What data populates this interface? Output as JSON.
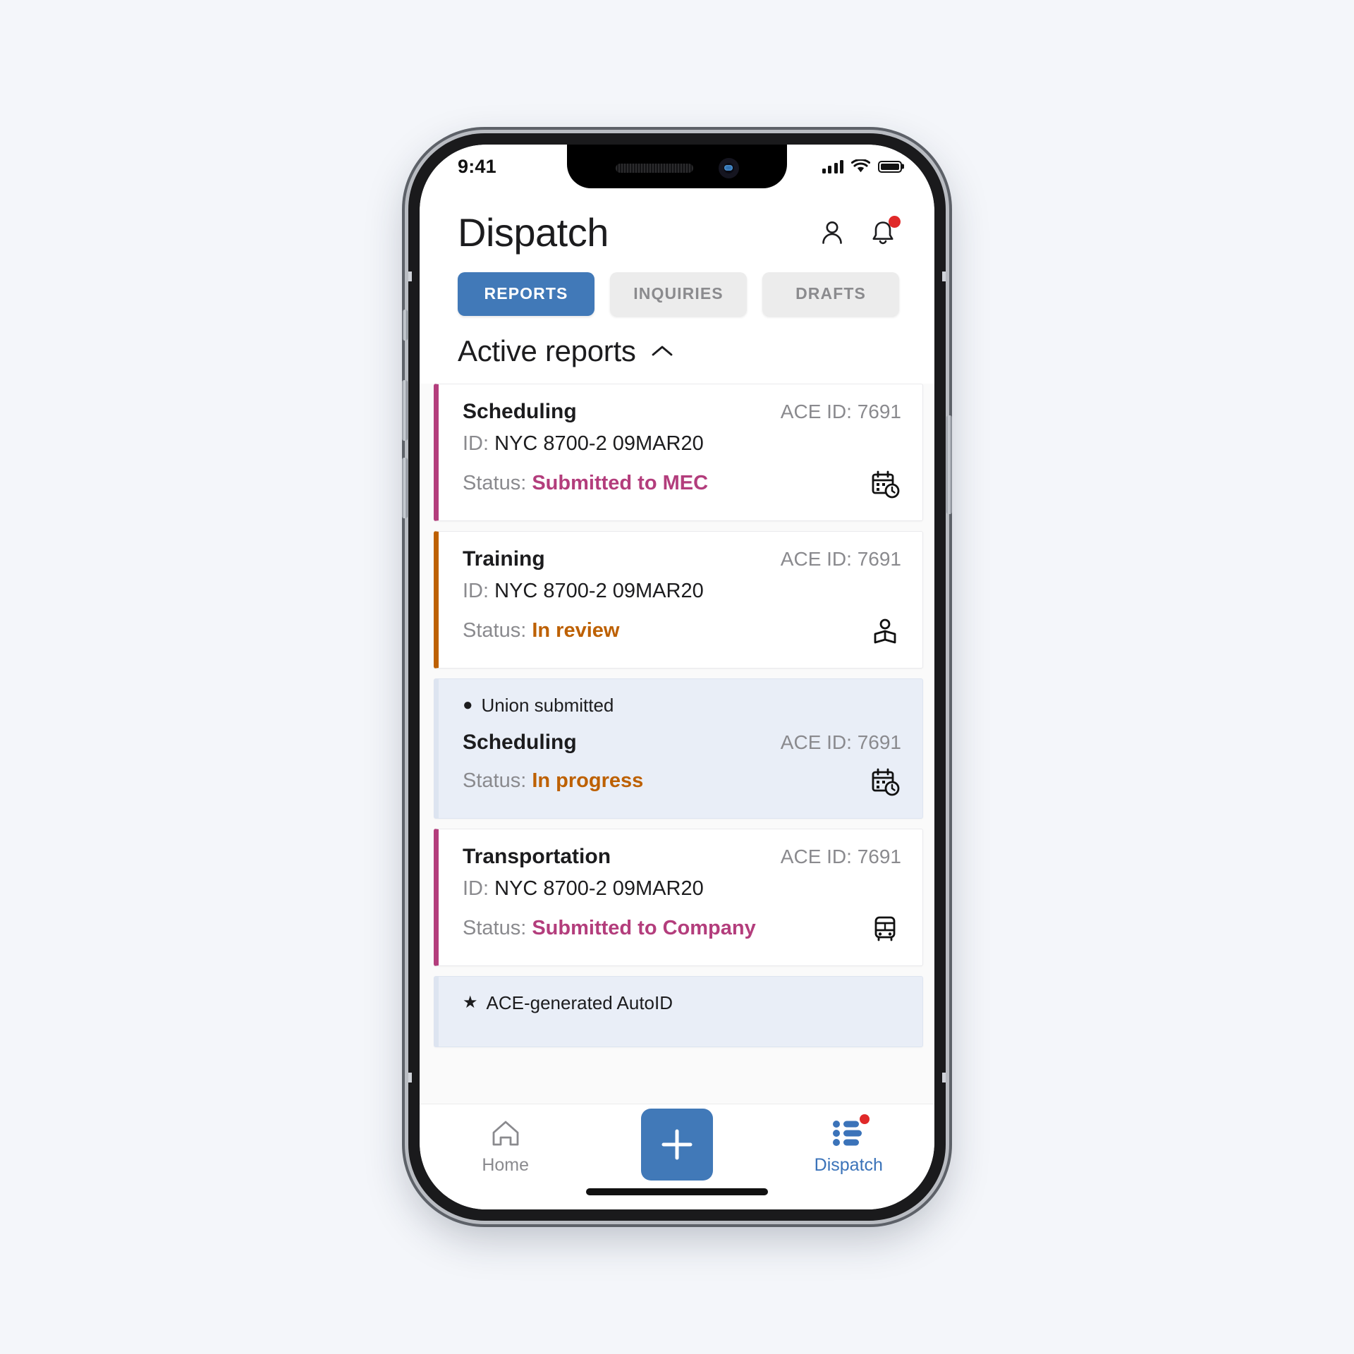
{
  "status_bar": {
    "time": "9:41",
    "signal_icon": "cellular-signal-icon",
    "wifi_icon": "wifi-icon",
    "battery_icon": "battery-icon"
  },
  "header": {
    "title": "Dispatch",
    "profile_icon": "person-icon",
    "notifications_icon": "bell-icon",
    "notifications_has_badge": true
  },
  "tabs": [
    {
      "label": "REPORTS",
      "active": true
    },
    {
      "label": "INQUIRIES",
      "active": false
    },
    {
      "label": "DRAFTS",
      "active": false
    }
  ],
  "section": {
    "title": "Active reports",
    "collapse_icon": "chevron-up-icon"
  },
  "cards": [
    {
      "flag": null,
      "flag_glyph": "",
      "type": "Scheduling",
      "ace_id": "ACE ID: 7691",
      "id_label": "ID:",
      "id_value": "NYC 8700-2 09MAR20",
      "status_label": "Status:",
      "status_value": "Submitted to MEC",
      "status_color": "#b33d7c",
      "accent": "#b33d7c",
      "icon": "calendar-clock-icon",
      "highlighted": false
    },
    {
      "flag": null,
      "flag_glyph": "",
      "type": "Training",
      "ace_id": "ACE ID: 7691",
      "id_label": "ID:",
      "id_value": "NYC 8700-2 09MAR20",
      "status_label": "Status:",
      "status_value": "In review",
      "status_color": "#bd6000",
      "accent": "#bd6000",
      "icon": "reading-person-icon",
      "highlighted": false
    },
    {
      "flag": "Union submitted",
      "flag_glyph": "●",
      "type": "Scheduling",
      "ace_id": "ACE ID: 7691",
      "id_label": "",
      "id_value": "",
      "status_label": "Status:",
      "status_value": "In progress",
      "status_color": "#bd6000",
      "accent": "#bd6000",
      "icon": "calendar-clock-icon",
      "highlighted": true
    },
    {
      "flag": null,
      "flag_glyph": "",
      "type": "Transportation",
      "ace_id": "ACE ID: 7691",
      "id_label": "ID:",
      "id_value": "NYC 8700-2 09MAR20",
      "status_label": "Status:",
      "status_value": "Submitted to Company",
      "status_color": "#b33d7c",
      "accent": "#b33d7c",
      "icon": "bus-icon",
      "highlighted": false
    },
    {
      "flag": "ACE-generated AutoID",
      "flag_glyph": "★",
      "type": "",
      "ace_id": "",
      "id_label": "",
      "id_value": "",
      "status_label": "",
      "status_value": "",
      "status_color": "#b33d7c",
      "accent": "#b33d7c",
      "icon": "",
      "highlighted": true
    }
  ],
  "bottom_nav": {
    "home": {
      "label": "Home",
      "icon": "home-icon",
      "active": false
    },
    "add": {
      "label": "",
      "icon": "plus-icon"
    },
    "dispatch": {
      "label": "Dispatch",
      "icon": "list-icon",
      "active": true,
      "has_badge": true
    }
  },
  "colors": {
    "accent_blue": "#4179b8",
    "status_magenta": "#b33d7c",
    "status_orange": "#bd6000",
    "badge_red": "#e02929",
    "highlight_bg": "#e9eef7",
    "page_bg": "#f4f6fa"
  }
}
